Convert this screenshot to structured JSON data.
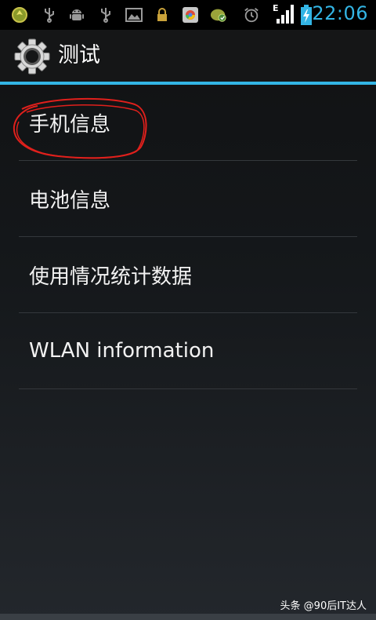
{
  "status_bar": {
    "time": "22:06",
    "network_type": "E",
    "accent_color": "#33b5e5",
    "icons": [
      "app-notification-icon",
      "usb-icon",
      "android-debug-icon",
      "usb-icon",
      "image-icon",
      "lock-icon",
      "app-icon",
      "download-icon",
      "alarm-icon",
      "signal-icon",
      "battery-charging-icon"
    ]
  },
  "action_bar": {
    "icon": "gear-icon",
    "title": "测试"
  },
  "list": {
    "items": [
      {
        "label": "手机信息",
        "annotated": true
      },
      {
        "label": "电池信息"
      },
      {
        "label": "使用情况统计数据"
      },
      {
        "label": "WLAN information"
      }
    ]
  },
  "annotation": {
    "color": "#e0201c"
  },
  "watermark": {
    "text": "头条 @90后IT达人"
  }
}
